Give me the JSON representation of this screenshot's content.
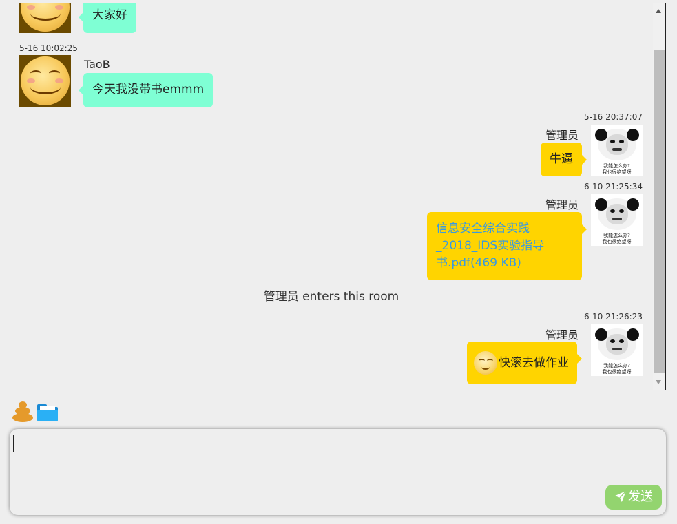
{
  "chat": {
    "messages": [
      {
        "sender": "",
        "time": "",
        "text": "大家好",
        "side": "left"
      },
      {
        "sender": "TaoB",
        "time": "5-16 10:02:25",
        "text": "今天我没带书emmm",
        "side": "left"
      },
      {
        "sender": "管理员",
        "time": "5-16 20:37:07",
        "text": "牛逼",
        "side": "right"
      },
      {
        "sender": "管理员",
        "time": "6-10 21:25:34",
        "file_line1": "信息安全综合实践",
        "file_line2": "_2018_IDS实验指导",
        "file_line3": "书.pdf(469 KB)",
        "side": "right"
      },
      {
        "system": "管理员 enters this room"
      },
      {
        "sender": "管理员",
        "time": "6-10 21:26:23",
        "text": "快滚去做作业",
        "side": "right"
      }
    ],
    "panda_caption_line1": "我能怎么办?",
    "panda_caption_line2": "我也很绝望呀"
  },
  "toolbar": {
    "emoji_icon": "poop-icon",
    "file_icon": "folder-icon"
  },
  "composer": {
    "value": "",
    "send_label": "发送",
    "send_icon": "paper-plane-icon"
  },
  "colors": {
    "left_bubble": "#7fffd4",
    "right_bubble": "#ffd400",
    "file_link": "#3a9adf",
    "send_button": "#93d46f"
  }
}
